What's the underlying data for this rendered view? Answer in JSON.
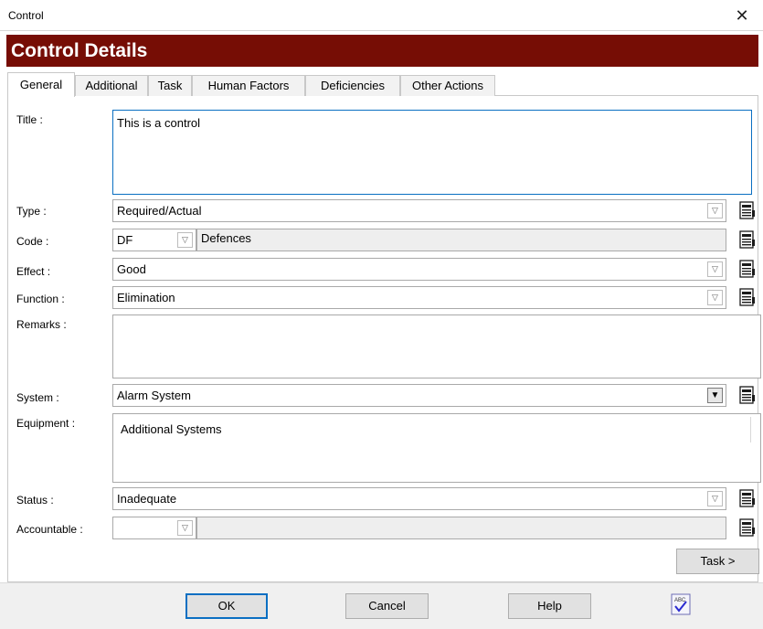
{
  "window": {
    "title": "Control",
    "close_glyph": "✕"
  },
  "banner": {
    "title": "Control Details"
  },
  "tabs": [
    {
      "label": "General",
      "active": true
    },
    {
      "label": "Additional"
    },
    {
      "label": "Task"
    },
    {
      "label": "Human Factors"
    },
    {
      "label": "Deficiencies"
    },
    {
      "label": "Other Actions"
    }
  ],
  "form": {
    "title": {
      "label": "Title :",
      "value": "This is a control"
    },
    "type": {
      "label": "Type :",
      "value": "Required/Actual"
    },
    "code": {
      "label": "Code :",
      "value": "DF",
      "description": "Defences"
    },
    "effect": {
      "label": "Effect :",
      "value": "Good"
    },
    "function": {
      "label": "Function :",
      "value": "Elimination"
    },
    "remarks": {
      "label": "Remarks :",
      "value": ""
    },
    "system": {
      "label": "System :",
      "value": "Alarm System"
    },
    "equipment": {
      "label": "Equipment :",
      "value": "Additional Systems"
    },
    "status": {
      "label": "Status :",
      "value": "Inadequate"
    },
    "accountable": {
      "label": "Accountable :",
      "value": "",
      "description": ""
    }
  },
  "task_button": "Task >",
  "footer": {
    "ok": "OK",
    "cancel": "Cancel",
    "help": "Help",
    "spell_icon_text": "ABC"
  },
  "icons": {
    "dropdown": "chevron-down-icon",
    "lookup": "lookup-list-icon",
    "spellcheck": "spellcheck-icon"
  },
  "colors": {
    "banner": "#760d05",
    "focus_border": "#0a6fc2",
    "lookup_icon": "#1a1a1a"
  }
}
